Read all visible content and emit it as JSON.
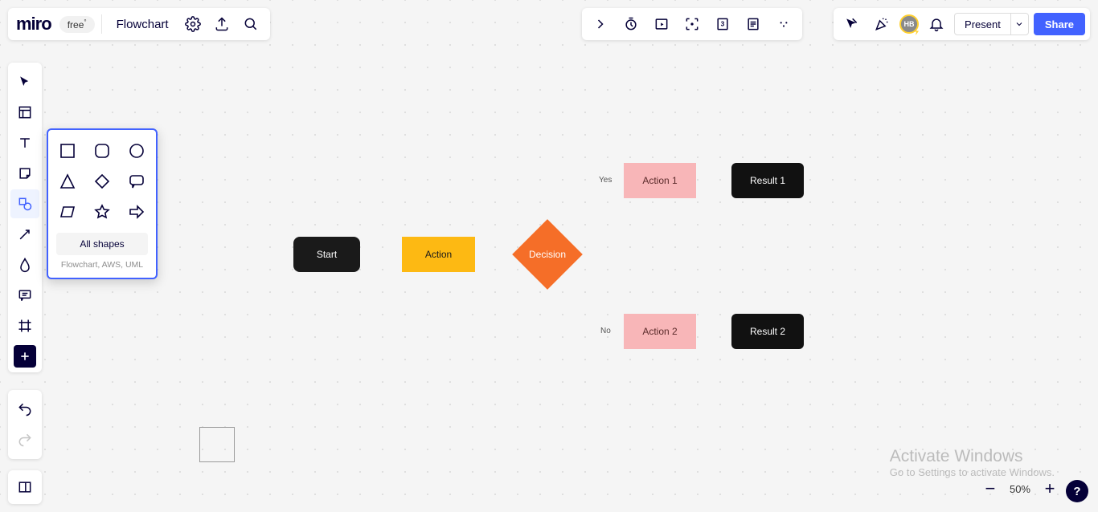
{
  "app": {
    "logo_text": "miro",
    "plan_badge": "free",
    "board_name": "Flowchart"
  },
  "top_right": {
    "avatar_initials": "HB",
    "present_label": "Present",
    "share_label": "Share"
  },
  "shapes_popover": {
    "all_shapes_label": "All shapes",
    "subtitle": "Flowchart, AWS, UML"
  },
  "flowchart": {
    "nodes": {
      "start": "Start",
      "action": "Action",
      "decision": "Decision",
      "action1": "Action 1",
      "action2": "Action 2",
      "result1": "Result 1",
      "result2": "Result 2"
    },
    "edge_labels": {
      "yes": "Yes",
      "no": "No"
    }
  },
  "zoom": {
    "level_label": "50%"
  },
  "help": {
    "glyph": "?"
  },
  "watermark": {
    "line1": "Activate Windows",
    "line2": "Go to Settings to activate Windows."
  }
}
